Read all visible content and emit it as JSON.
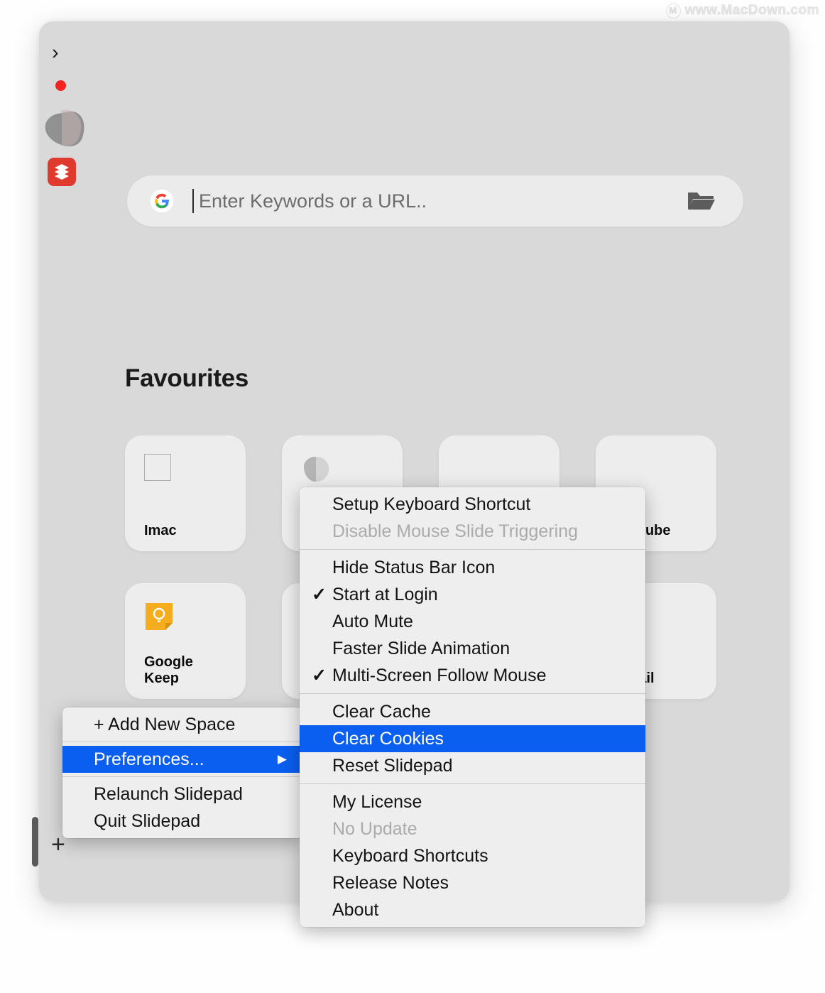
{
  "watermark": {
    "text": "www.MacDown.com",
    "badge": "M"
  },
  "sidebar": {
    "chevron_icon": "chevron-right-icon",
    "items": [
      {
        "name": "red-dot-indicator",
        "label": ""
      },
      {
        "name": "space-thumbnail-blob",
        "label": ""
      },
      {
        "name": "todoist-app-icon",
        "label": ""
      }
    ],
    "add_label": "+",
    "handle_label": ""
  },
  "search": {
    "engine_icon": "google-g-icon",
    "placeholder": "Enter Keywords or a URL..",
    "value": "",
    "folder_icon": "open-folder-icon"
  },
  "favourites": {
    "title": "Favourites",
    "rows": [
      [
        {
          "label": "Imac",
          "icon": "square-outline-icon"
        },
        {
          "label": "",
          "icon": "gray-blob-icon"
        },
        {
          "label": "",
          "icon": ""
        },
        {
          "label": "Youtube",
          "icon": ""
        }
      ],
      [
        {
          "label": "Google\nKeep",
          "label_line1": "Google",
          "label_line2": "Keep",
          "icon": "google-keep-icon"
        },
        {
          "label": "",
          "icon": "colored-dots-icon"
        },
        {
          "label": "",
          "icon": ""
        },
        {
          "label": "Gmail",
          "icon": ""
        }
      ]
    ]
  },
  "menus": {
    "space_menu": {
      "items": [
        {
          "label": "+ Add New Space",
          "state": "normal",
          "checked": false,
          "submenu": false
        },
        {
          "label": "Preferences...",
          "state": "selected",
          "checked": false,
          "submenu": true
        },
        {
          "label": "Relaunch Slidepad",
          "state": "normal",
          "checked": false,
          "submenu": false
        },
        {
          "label": "Quit Slidepad",
          "state": "normal",
          "checked": false,
          "submenu": false
        }
      ]
    },
    "preferences_menu": {
      "group1": [
        {
          "label": "Setup Keyboard Shortcut",
          "state": "normal",
          "checked": false
        },
        {
          "label": "Disable Mouse Slide Triggering",
          "state": "disabled",
          "checked": false
        }
      ],
      "group2": [
        {
          "label": "Hide Status Bar Icon",
          "state": "normal",
          "checked": false
        },
        {
          "label": "Start at Login",
          "state": "normal",
          "checked": true
        },
        {
          "label": "Auto Mute",
          "state": "normal",
          "checked": false
        },
        {
          "label": "Faster Slide Animation",
          "state": "normal",
          "checked": false
        },
        {
          "label": "Multi-Screen Follow Mouse",
          "state": "normal",
          "checked": true
        }
      ],
      "group3": [
        {
          "label": "Clear Cache",
          "state": "normal",
          "checked": false
        },
        {
          "label": "Clear Cookies",
          "state": "selected",
          "checked": false
        },
        {
          "label": "Reset Slidepad",
          "state": "normal",
          "checked": false
        }
      ],
      "group4": [
        {
          "label": "My License",
          "state": "normal",
          "checked": false
        },
        {
          "label": "No Update",
          "state": "disabled",
          "checked": false
        },
        {
          "label": "Keyboard Shortcuts",
          "state": "normal",
          "checked": false
        },
        {
          "label": "Release Notes",
          "state": "normal",
          "checked": false
        },
        {
          "label": "About",
          "state": "normal",
          "checked": false
        }
      ]
    },
    "checkmark_glyph": "✓",
    "submenu_glyph": "▶",
    "highlight_color": "#0a5ff0"
  }
}
